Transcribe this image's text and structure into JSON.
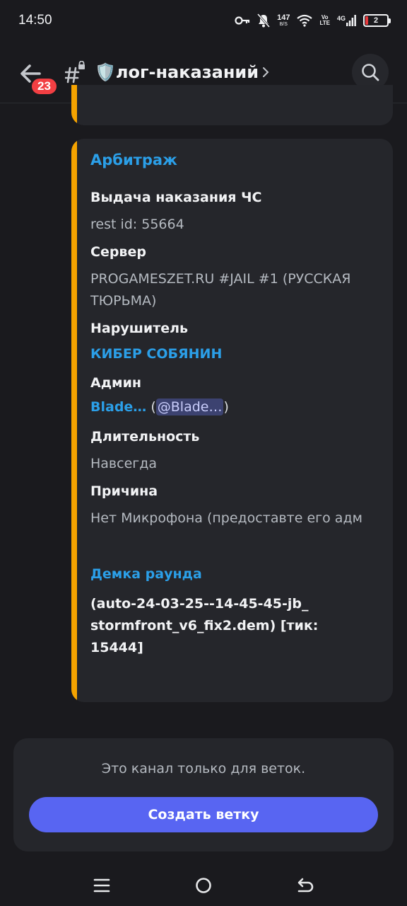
{
  "status_bar": {
    "time": "14:50",
    "net_speed": "147",
    "net_speed_unit": "B/S",
    "volte_top": "Vo",
    "volte_bottom": "LTE",
    "signal_label": "4G",
    "battery_level": "2",
    "battery_color": "#e5383b"
  },
  "header": {
    "unread_badge": "23",
    "channel_name": "🛡️лог-наказаний"
  },
  "embed": {
    "accent_color": "#f5a300",
    "title": "Арбитраж",
    "fields": {
      "action_name": "Выдача наказания ЧС",
      "action_value": "rest id: 55664",
      "server_name": "Сервер",
      "server_value": "PROGAMESZET.RU #JAIL #1 (РУССКАЯ ТЮРЬМА)",
      "offender_name": "Нарушитель",
      "offender_value": "КИБЕР СОБЯНИН",
      "admin_name": "Админ",
      "admin_link": "Blade…",
      "admin_open": " (",
      "admin_mention": "@Blade…",
      "admin_close": ")",
      "duration_name": "Длительность",
      "duration_value": "Навсегда",
      "reason_name": "Причина",
      "reason_value": "Нет Микрофона (предоставте его адм"
    },
    "demo_title": "Демка раунда",
    "demo_value": "(auto-24-03-25--14-45-45-jb_ stormfront_v6_fix2.dem) [тик: 15444]"
  },
  "thread_panel": {
    "message": "Это канал только для веток.",
    "button_label": "Создать ветку",
    "button_color": "#5865f2"
  },
  "nav_bar": {
    "icons": [
      "menu-icon",
      "home-icon",
      "back-icon"
    ]
  }
}
